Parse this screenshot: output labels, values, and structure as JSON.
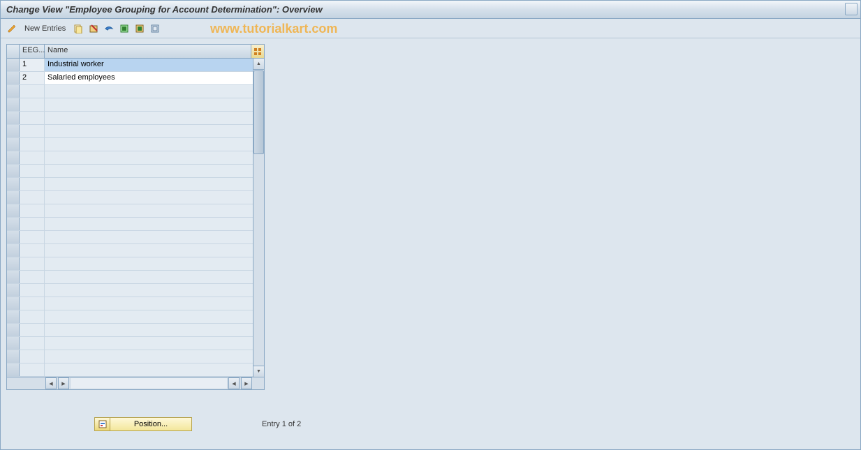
{
  "title": "Change View \"Employee Grouping for Account Determination\": Overview",
  "toolbar": {
    "new_entries_label": "New Entries"
  },
  "watermark": "www.tutorialkart.com",
  "table": {
    "columns": {
      "eeg": "EEG...",
      "name": "Name"
    },
    "rows": [
      {
        "eeg": "1",
        "name": "Industrial worker",
        "selected": true
      },
      {
        "eeg": "2",
        "name": "Salaried employees",
        "selected": false
      }
    ],
    "empty_row_count": 22
  },
  "footer": {
    "position_label": "Position...",
    "entry_status": "Entry 1 of 2"
  }
}
